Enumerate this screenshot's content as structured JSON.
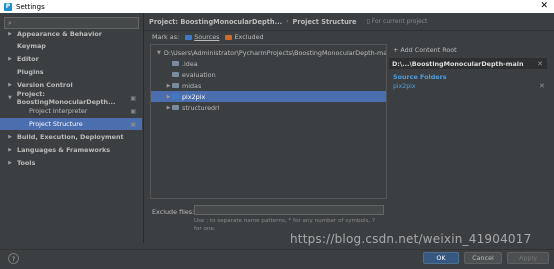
{
  "window": {
    "title": "Settings"
  },
  "sidebar": {
    "search_placeholder": "",
    "items": [
      {
        "label": "Appearance & Behavior",
        "arrow": "▶",
        "bold": true
      },
      {
        "label": "Keymap",
        "arrow": "",
        "bold": true
      },
      {
        "label": "Editor",
        "arrow": "▶",
        "bold": true
      },
      {
        "label": "Plugins",
        "arrow": "",
        "bold": true
      },
      {
        "label": "Version Control",
        "arrow": "▶",
        "bold": true
      },
      {
        "label": "Project: BoostingMonocularDepth...",
        "arrow": "▼",
        "bold": true
      },
      {
        "label": "Project Interpreter",
        "arrow": "",
        "bold": false
      },
      {
        "label": "Project Structure",
        "arrow": "",
        "bold": false
      },
      {
        "label": "Build, Execution, Deployment",
        "arrow": "▶",
        "bold": true
      },
      {
        "label": "Languages & Frameworks",
        "arrow": "▶",
        "bold": true
      },
      {
        "label": "Tools",
        "arrow": "▶",
        "bold": true
      }
    ]
  },
  "header": {
    "project": "Project: BoostingMonocularDepth...",
    "separator": "›",
    "page": "Project Structure",
    "for_current": "For current project"
  },
  "markas": {
    "label": "Mark as:",
    "sources": "Sources",
    "excluded": "Excluded"
  },
  "tree": {
    "rows": [
      {
        "label": "D:\\Users\\Administrator\\PycharmProjects\\BoostingMonocularDepth-main",
        "arrow": "▼",
        "indent": 0,
        "blue": false
      },
      {
        "label": ".idea",
        "arrow": "",
        "indent": 1,
        "blue": false
      },
      {
        "label": "evaluation",
        "arrow": "",
        "indent": 1,
        "blue": false
      },
      {
        "label": "midas",
        "arrow": "▶",
        "indent": 1,
        "blue": false
      },
      {
        "label": "pix2pix",
        "arrow": "▶",
        "indent": 1,
        "blue": true
      },
      {
        "label": "structuredrl",
        "arrow": "▶",
        "indent": 1,
        "blue": false
      }
    ]
  },
  "exclude": {
    "label": "Exclude files:",
    "value": "",
    "hint": "Use ; to separate name patterns, * for any number of symbols, ? for one."
  },
  "right": {
    "add_root": "Add Content Root",
    "root_title": "D:\\...\\BoostingMonocularDepth-main",
    "source_folders": "Source Folders",
    "source_item": "pix2pix"
  },
  "footer": {
    "help": "?",
    "ok": "OK",
    "cancel": "Cancel",
    "apply": "Apply"
  },
  "watermark": "https://blog.csdn.net/weixin_41904017"
}
